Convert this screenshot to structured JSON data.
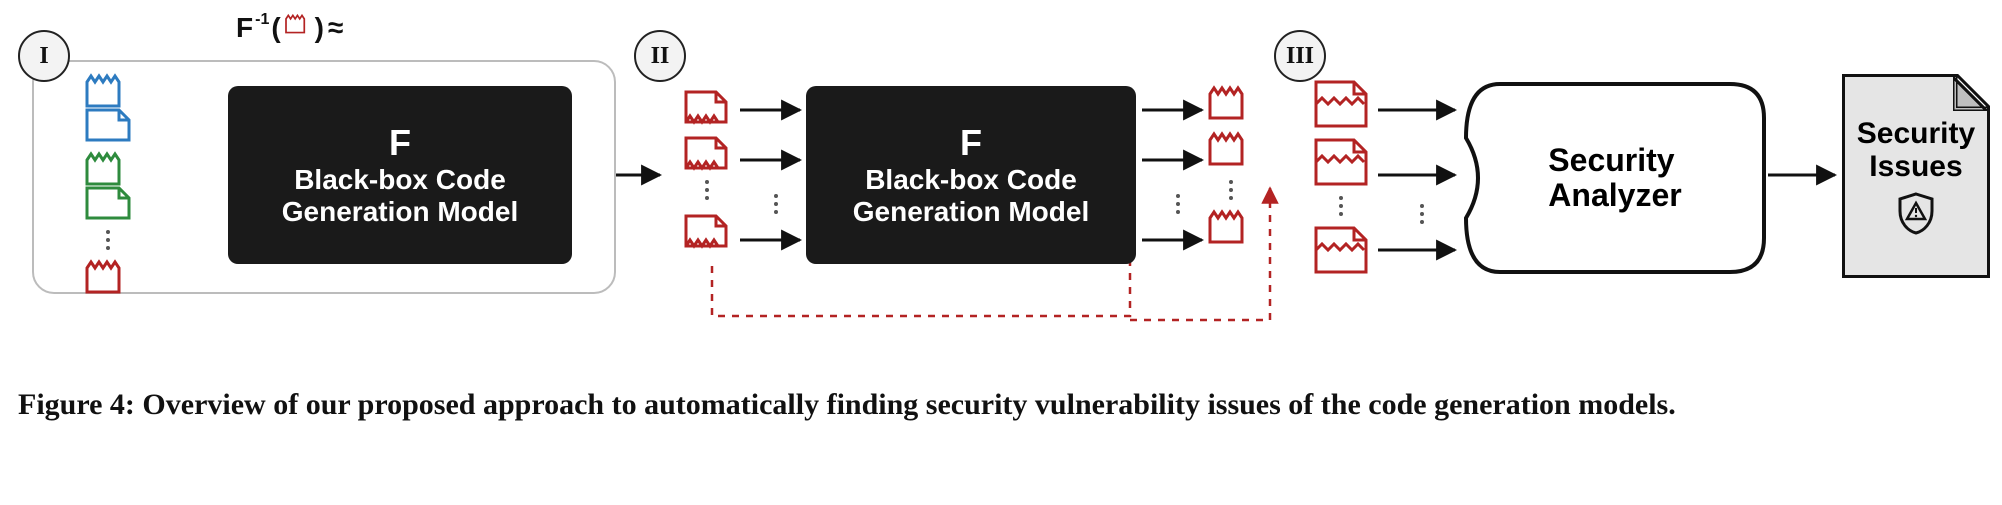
{
  "badges": {
    "one": "I",
    "two": "II",
    "three": "III"
  },
  "formula": {
    "f": "F",
    "inv": "-1",
    "approx": "≈"
  },
  "blackbox": {
    "f": "F",
    "line1": "Black-box Code",
    "line2": "Generation Model"
  },
  "analyzer": {
    "line1": "Security",
    "line2": "Analyzer"
  },
  "issues": {
    "line1": "Security",
    "line2": "Issues"
  },
  "caption": "Figure 4: Overview of our proposed approach to automatically finding security vulnerability issues of the code generation models.",
  "colors": {
    "blue": "#2d7bc0",
    "green": "#2e8b3d",
    "red": "#b32323",
    "dark": "#111111",
    "grey": "#bcbcbc"
  },
  "layout": {
    "stages": 3,
    "blackbox_count": 2,
    "file_columns": [
      "stage1_inputs",
      "stage2_prompts",
      "stage2_outputs",
      "stage3_files"
    ]
  }
}
